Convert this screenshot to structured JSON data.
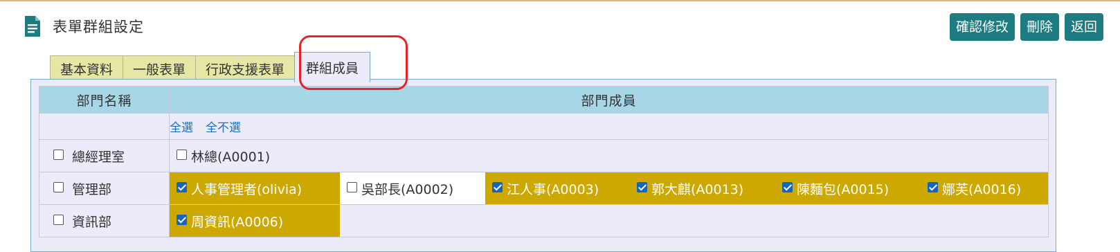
{
  "page": {
    "title": "表單群組設定"
  },
  "actions": {
    "confirm": "確認修改",
    "delete": "刪除",
    "back": "返回"
  },
  "tabs": [
    {
      "label": "基本資料"
    },
    {
      "label": "一般表單"
    },
    {
      "label": "行政支援表單"
    },
    {
      "label": "群組成員"
    }
  ],
  "active_tab": "群組成員",
  "table": {
    "headers": {
      "department": "部門名稱",
      "members": "部門成員"
    },
    "select_all": "全選",
    "deselect_all": "全不選",
    "departments": [
      {
        "name": "總經理室",
        "checked": false,
        "members": [
          {
            "name": "林總(A0001)",
            "checked": false
          }
        ]
      },
      {
        "name": "管理部",
        "checked": false,
        "members": [
          {
            "name": "人事管理者(olivia)",
            "checked": true
          },
          {
            "name": "吳部長(A0002)",
            "checked": false
          },
          {
            "name": "江人事(A0003)",
            "checked": true
          },
          {
            "name": "郭大麒(A0013)",
            "checked": true
          },
          {
            "name": "陳麵包(A0015)",
            "checked": true
          },
          {
            "name": "娜芙(A0016)",
            "checked": true
          }
        ]
      },
      {
        "name": "資訊部",
        "checked": false,
        "members": [
          {
            "name": "周資訊(A0006)",
            "checked": true
          }
        ]
      }
    ]
  },
  "colors": {
    "button_bg": "#1c7c82",
    "header_bg": "#a7d6e6",
    "checked_member_bg": "#cca800",
    "tab_bg": "#e5e7a4",
    "panel_bg": "#ecebfa",
    "highlight": "#e3242b"
  },
  "icons": {
    "page_icon": "document-icon",
    "checkbox": "checkbox-icon"
  }
}
